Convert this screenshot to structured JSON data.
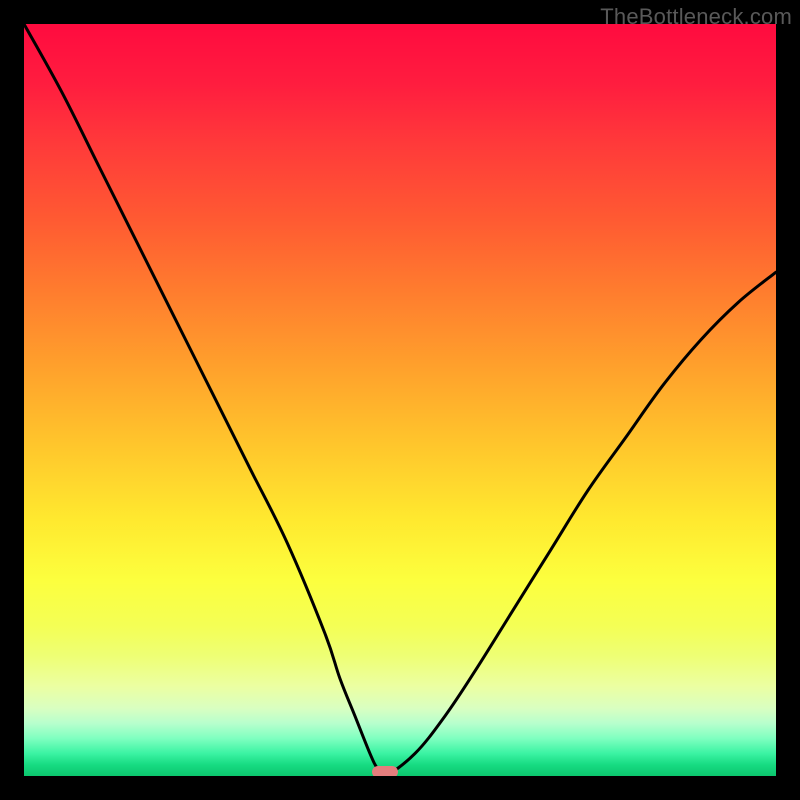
{
  "credit": "TheBottleneck.com",
  "accent_marker_color": "#e47d7d",
  "chart_data": {
    "type": "line",
    "title": "",
    "xlabel": "",
    "ylabel": "",
    "xlim": [
      0,
      100
    ],
    "ylim": [
      0,
      100
    ],
    "grid": false,
    "legend": false,
    "series": [
      {
        "name": "bottleneck-curve",
        "x": [
          0,
          5,
          10,
          15,
          20,
          25,
          30,
          35,
          40,
          42,
          44,
          46,
          47,
          48,
          52,
          56,
          60,
          65,
          70,
          75,
          80,
          85,
          90,
          95,
          100
        ],
        "values": [
          100,
          91,
          81,
          71,
          61,
          51,
          41,
          31,
          19,
          13,
          8,
          3,
          1,
          0,
          3,
          8,
          14,
          22,
          30,
          38,
          45,
          52,
          58,
          63,
          67
        ]
      }
    ],
    "annotations": [
      {
        "name": "min-marker",
        "x": 48,
        "y": 0.5
      }
    ]
  }
}
